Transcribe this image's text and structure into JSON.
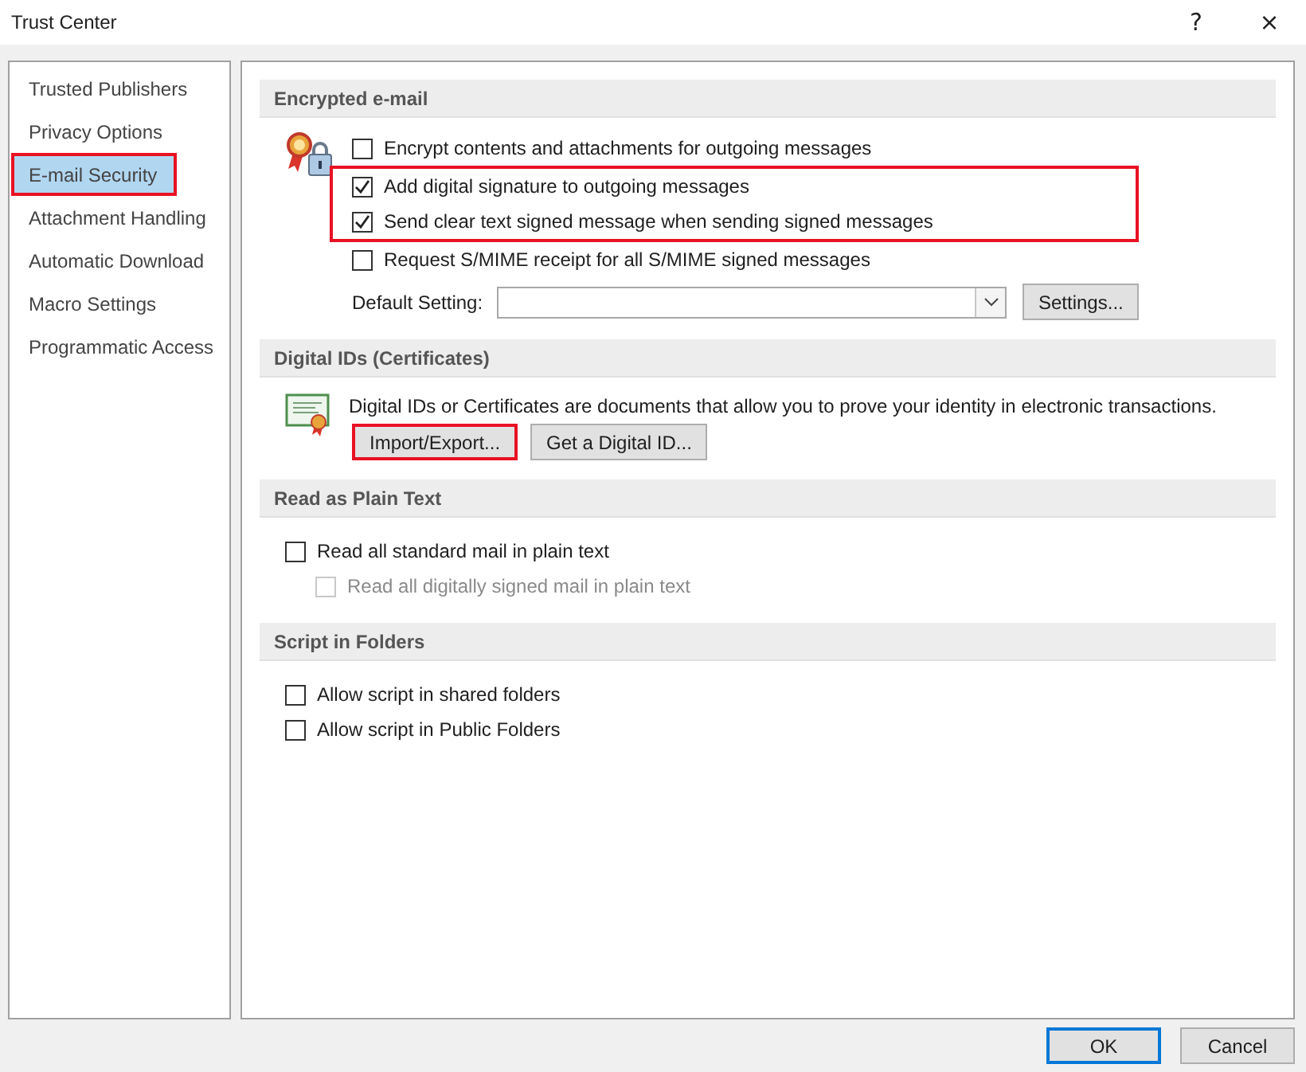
{
  "window": {
    "title": "Trust Center",
    "help": "?",
    "close": "×"
  },
  "sidebar": {
    "items": [
      {
        "label": "Trusted Publishers",
        "selected": false,
        "highlighted": false
      },
      {
        "label": "Privacy Options",
        "selected": false,
        "highlighted": false
      },
      {
        "label": "E-mail Security",
        "selected": true,
        "highlighted": true
      },
      {
        "label": "Attachment Handling",
        "selected": false,
        "highlighted": false
      },
      {
        "label": "Automatic Download",
        "selected": false,
        "highlighted": false
      },
      {
        "label": "Macro Settings",
        "selected": false,
        "highlighted": false
      },
      {
        "label": "Programmatic Access",
        "selected": false,
        "highlighted": false
      }
    ]
  },
  "sections": [
    {
      "title": "Encrypted e-mail",
      "options": [
        {
          "label": "Encrypt contents and attachments for outgoing messages",
          "checked": false,
          "disabled": false,
          "highlighted": false
        },
        {
          "label": "Add digital signature to outgoing messages",
          "checked": true,
          "disabled": false,
          "highlighted": true
        },
        {
          "label": "Send clear text signed message when sending signed messages",
          "checked": true,
          "disabled": false,
          "highlighted": true
        },
        {
          "label": "Request S/MIME receipt for all S/MIME signed messages",
          "checked": false,
          "disabled": false,
          "highlighted": false
        }
      ],
      "dropdown": {
        "label": "Default Setting:",
        "button": {
          "label": "Settings...",
          "highlighted": false
        }
      }
    },
    {
      "title": "Digital IDs (Certificates)",
      "description": "Digital IDs or Certificates are documents that allow you to prove your identity in electronic transactions.",
      "buttons": [
        {
          "label": "Import/Export...",
          "highlighted": true
        },
        {
          "label": "Get a Digital ID...",
          "highlighted": false
        }
      ]
    },
    {
      "title": "Read as Plain Text",
      "options": [
        {
          "label": "Read all standard mail in plain text",
          "checked": false,
          "disabled": false,
          "highlighted": false,
          "children": [
            {
              "label": "Read all digitally signed mail in plain text",
              "checked": false,
              "disabled": true,
              "highlighted": false
            }
          ]
        }
      ]
    },
    {
      "title": "Script in Folders",
      "options": [
        {
          "label": "Allow script in shared folders",
          "checked": false,
          "disabled": false,
          "highlighted": false
        },
        {
          "label": "Allow script in Public Folders",
          "checked": false,
          "disabled": false,
          "highlighted": false
        }
      ]
    }
  ],
  "footer": {
    "buttons": [
      {
        "label": "OK",
        "default": true
      },
      {
        "label": "Cancel",
        "default": false
      }
    ]
  }
}
